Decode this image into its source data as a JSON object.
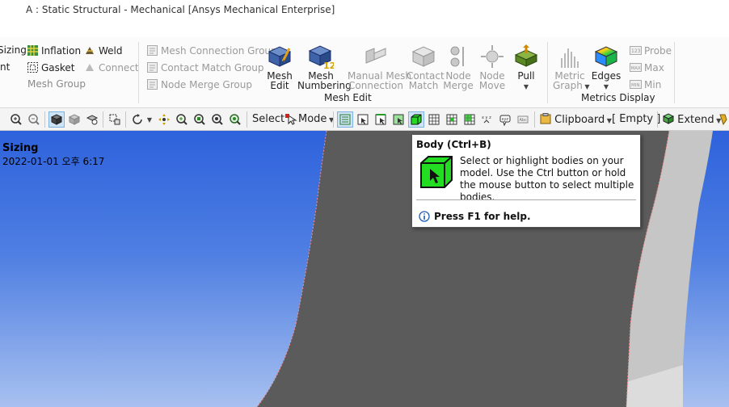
{
  "window": {
    "title": "A : Static Structural - Mechanical [Ansys Mechanical Enterprise]"
  },
  "ribbon": {
    "left_group": {
      "sizing": "Sizing",
      "nt": "nt",
      "inflation": "Inflation",
      "gasket": "Gasket",
      "weld": "Weld",
      "connect": "Connect",
      "label": "Mesh Group"
    },
    "connection_group": {
      "mesh_connection_group": "Mesh Connection Group",
      "contact_match_group": "Contact Match Group",
      "node_merge_group": "Node Merge Group"
    },
    "mesh_edit": {
      "label": "Mesh Edit",
      "mesh_edit_1": "Mesh",
      "mesh_edit_2": "Edit",
      "mesh_numbering_1": "Mesh",
      "mesh_numbering_2": "Numbering",
      "manual_mesh_1": "Manual Mesh",
      "manual_mesh_2": "Connection",
      "contact_match_1": "Contact",
      "contact_match_2": "Match",
      "node_merge_1": "Node",
      "node_merge_2": "Merge",
      "node_move_1": "Node",
      "node_move_2": "Move",
      "pull": "Pull",
      "numbering_badge": "12"
    },
    "metrics_display": {
      "label": "Metrics Display",
      "metric_graph_1": "Metric",
      "metric_graph_2": "Graph",
      "edges": "Edges",
      "probe": "Probe",
      "max": "Max",
      "min": "Min"
    }
  },
  "toolbar": {
    "select": "Select",
    "mode": "Mode",
    "clipboard": "Clipboard",
    "empty": "[ Empty ]",
    "extend": "Extend"
  },
  "viewport": {
    "title": "Sizing",
    "date": "2022-01-01 오후 6:17"
  },
  "tooltip": {
    "title": "Body (Ctrl+B)",
    "description": "Select or highlight bodies on your model. Use the Ctrl button or hold the mouse button to select multiple bodies.",
    "help": "Press F1 for help."
  },
  "colors": {
    "viewport_top": "#2e62dc",
    "viewport_bottom": "#a7c0ef",
    "body_gray": "#5b5b5b",
    "body_light": "#c8c8c8",
    "body_icon_green": "#22dd22",
    "selected_tool": "#cde4f7"
  }
}
